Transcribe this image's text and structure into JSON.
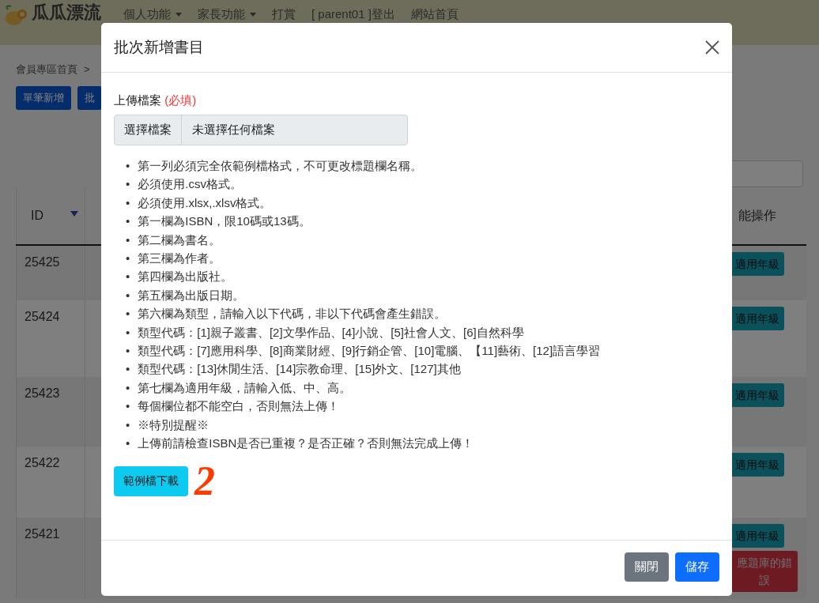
{
  "header": {
    "logo_text": "瓜瓜漂流",
    "nav": [
      {
        "label": "個人功能",
        "has_caret": true
      },
      {
        "label": "家長功能",
        "has_caret": true
      },
      {
        "label": "打賞",
        "has_caret": false
      },
      {
        "label": "[ parent01 ]登出",
        "has_caret": false
      },
      {
        "label": "網站首頁",
        "has_caret": false
      }
    ]
  },
  "breadcrumb": [
    "會員專區首頁",
    ">"
  ],
  "toolbar": [
    "單筆新增",
    "批"
  ],
  "table": {
    "columns": [
      {
        "label": "ID",
        "sorted": true
      },
      {
        "label": "能操作",
        "sorted": false
      }
    ],
    "rows": [
      {
        "id": "25425",
        "actions": [
          "適用年級"
        ]
      },
      {
        "id": "25424",
        "actions": [
          "適用年級"
        ]
      },
      {
        "id": "25423",
        "actions": [
          "適用年級"
        ]
      },
      {
        "id": "25422",
        "actions": [
          "適用年級"
        ]
      },
      {
        "id": "25421",
        "actions": [
          "適用年級",
          "應題庫的錯誤"
        ]
      }
    ]
  },
  "modal": {
    "title": "批次新增書目",
    "field_label": "上傳檔案",
    "required_mark": "(必填)",
    "file_button": "選擇檔案",
    "file_status": "未選擇任何檔案",
    "bullet": "•",
    "rules": [
      "第一列必須完全依範例檔格式，不可更改標題欄名稱。",
      "必須使用.csv格式。",
      "必須使用.xlsx,.xlsv格式。",
      "第一欄為ISBN，限10碼或13碼。",
      "第二欄為書名。",
      "第三欄為作者。",
      "第四欄為出版社。",
      "第五欄為出版日期。",
      "第六欄為類型，請輸入以下代碼，非以下代碼會產生錯誤。",
      "類型代碼：[1]親子叢書、[2]文學作品、[4]小說、[5]社會人文、[6]自然科學",
      "類型代碼：[7]應用科學、[8]商業財經、[9]行銷企管、[10]電腦、【11]藝術、[12]語言學習",
      "類型代碼：[13]休閒生活、[14]宗教命理、[15]外文、[127]其他",
      "第七欄為適用年級，請輸入低、中、高。",
      "每個欄位都不能空白，否則無法上傳！",
      "※特別提醒※",
      "上傳前請檢查ISBN是否已重複？是否正確？否則無法完成上傳！"
    ],
    "download_button": "範例檔下載",
    "annotation": "2",
    "footer_buttons": [
      {
        "label": "關閉",
        "kind": "secondary"
      },
      {
        "label": "儲存",
        "kind": "primary"
      }
    ]
  }
}
